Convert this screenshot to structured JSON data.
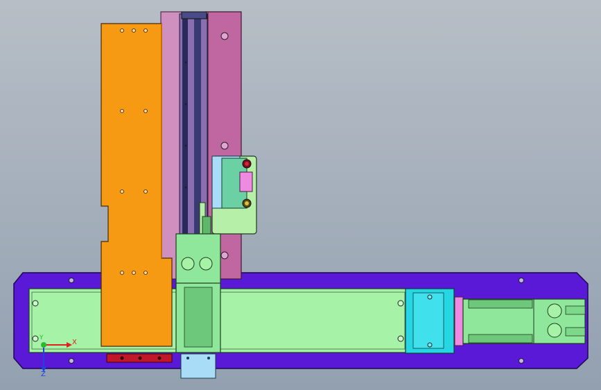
{
  "viewport": {
    "background_top": "#b7bec6",
    "background_bottom": "#93a0b0"
  },
  "model": {
    "parts": [
      "base-plate",
      "linear-rail",
      "motor-coupling-block",
      "servo-motor",
      "orange-cover-plate",
      "magenta-vertical-plate",
      "vertical-rail",
      "sensor-bracket",
      "slider-carriage",
      "bottom-block"
    ],
    "colors": {
      "base_plate": "#5a19d6",
      "rail": "#a6f2a6",
      "cover_plate": "#f59a12",
      "vertical_plate": "#c066a0",
      "coupling": "#26d6e2",
      "motor_flange": "#ee8be0",
      "sensor_bracket": "#b6f0a8",
      "carriage": "#8ee79a",
      "bottom_block": "#a9dcf6",
      "red_bar": "#c0182a"
    }
  },
  "triad": {
    "x_label": "X",
    "y_label": "Y",
    "z_label": "Z",
    "x_color": "#e02020",
    "y_color": "#22c022",
    "z_color": "#2040e0"
  }
}
